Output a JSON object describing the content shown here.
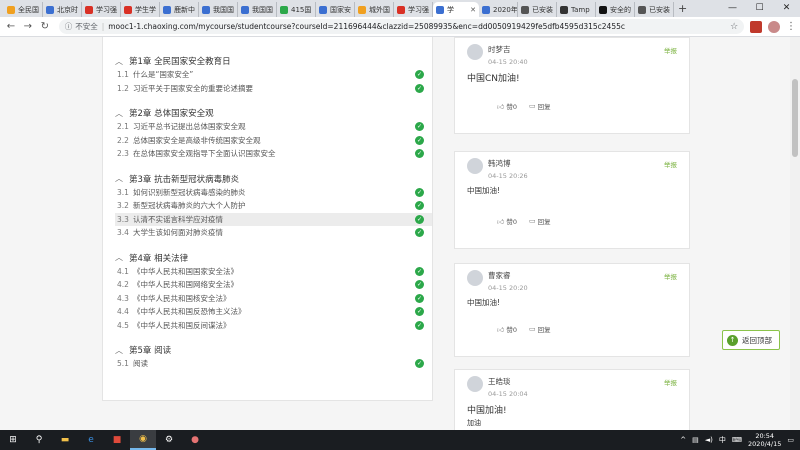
{
  "tabs": [
    {
      "label": "全民国",
      "color": "#f0a020"
    },
    {
      "label": "北京时",
      "color": "#3b6fd1"
    },
    {
      "label": "学习强",
      "color": "#d93025"
    },
    {
      "label": "学生学",
      "color": "#d93025"
    },
    {
      "label": "鹿新中",
      "color": "#3b6fd1"
    },
    {
      "label": "我国国",
      "color": "#3b6fd1"
    },
    {
      "label": "我国国",
      "color": "#3b6fd1"
    },
    {
      "label": "415国",
      "color": "#2ca84a"
    },
    {
      "label": "国家安",
      "color": "#3b6fd1"
    },
    {
      "label": "城外国",
      "color": "#f0a020"
    },
    {
      "label": "学习强",
      "color": "#d93025"
    },
    {
      "label": "学",
      "color": "#3b6fd1",
      "active": true
    },
    {
      "label": "2020年",
      "color": "#3b6fd1"
    },
    {
      "label": "已安装",
      "color": "#555555"
    },
    {
      "label": "Tamp",
      "color": "#333333"
    },
    {
      "label": "安全的",
      "color": "#111111"
    },
    {
      "label": "已安装",
      "color": "#555555"
    }
  ],
  "browser": {
    "security": "不安全",
    "url": "mooc1-1.chaoxing.com/mycourse/studentcourse?courseId=211696444&clazzid=25089935&enc=dd0050919429fe5dfb4595d315c2455c"
  },
  "toc": [
    {
      "title": "第1章 全民国家安全教育日",
      "sections": [
        {
          "num": "1.1",
          "title": "什么是“国家安全”"
        },
        {
          "num": "1.2",
          "title": "习近平关于国家安全的重要论述摘要"
        }
      ]
    },
    {
      "title": "第2章 总体国家安全观",
      "sections": [
        {
          "num": "2.1",
          "title": "习近平总书记提出总体国家安全观"
        },
        {
          "num": "2.2",
          "title": "总体国家安全是高级非传统国家安全观"
        },
        {
          "num": "2.3",
          "title": "在总体国家安全观指导下全面认识国家安全"
        }
      ]
    },
    {
      "title": "第3章 抗击新型冠状病毒肺炎",
      "sections": [
        {
          "num": "3.1",
          "title": "如何识别新型冠状病毒感染的肺炎"
        },
        {
          "num": "3.2",
          "title": "新型冠状病毒肺炎的六大个人防护"
        },
        {
          "num": "3.3",
          "title": "认清不实谣言科学应对疫情"
        },
        {
          "num": "3.4",
          "title": "大学生该如何面对肺炎疫情"
        }
      ]
    },
    {
      "title": "第4章 相关法律",
      "sections": [
        {
          "num": "4.1",
          "title": "《中华人民共和国国家安全法》"
        },
        {
          "num": "4.2",
          "title": "《中华人民共和国网络安全法》"
        },
        {
          "num": "4.3",
          "title": "《中华人民共和国核安全法》"
        },
        {
          "num": "4.4",
          "title": "《中华人民共和国反恐怖主义法》"
        },
        {
          "num": "4.5",
          "title": "《中华人民共和国反间谍法》"
        }
      ]
    },
    {
      "title": "第5章 阅读",
      "sections": [
        {
          "num": "5.1",
          "title": "阅读"
        }
      ]
    }
  ],
  "comments": [
    {
      "name": "时梦吉",
      "time": "04-15 20:40",
      "report": "举报",
      "text": "中国CN加油!",
      "like": "赞0",
      "reply": "回复"
    },
    {
      "name": "韩鸿博",
      "time": "04-15 20:26",
      "report": "举报",
      "text": "中国加油!",
      "like": "赞0",
      "reply": "回复"
    },
    {
      "name": "曹家睿",
      "time": "04-15 20:20",
      "report": "举报",
      "text": "中国加油!",
      "like": "赞0",
      "reply": "回复"
    },
    {
      "name": "王皓琰",
      "time": "04-15 20:04",
      "report": "举报",
      "text": "中国加油!",
      "subtext": "加油"
    }
  ],
  "back_to_top": "返回顶部",
  "taskbar": {
    "ime": "中",
    "time": "20:54",
    "date": "2020/4/15"
  }
}
